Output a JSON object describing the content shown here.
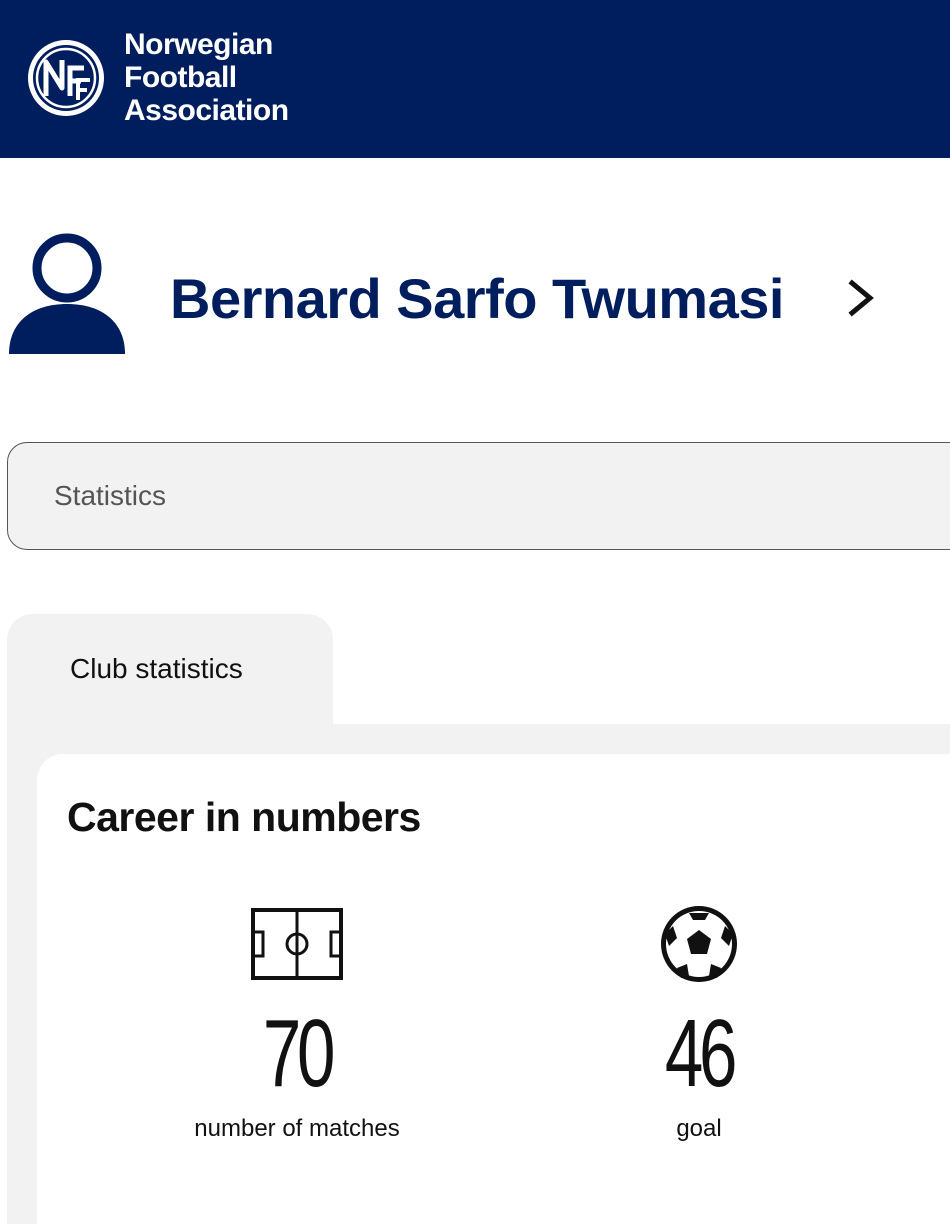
{
  "header": {
    "brand_line1": "Norwegian",
    "brand_line2": "Football",
    "brand_line3": "Association",
    "logo_icon": "nff-logo-icon",
    "background_color": "#001e5e"
  },
  "player": {
    "name": "Bernard Sarfo Twumasi",
    "avatar_icon": "person-icon",
    "chevron_icon": "chevron-right-icon",
    "name_color": "#001e5e"
  },
  "statistics_dropdown": {
    "label": "Statistics"
  },
  "tabs": [
    {
      "label": "Club statistics",
      "active": true
    }
  ],
  "career": {
    "title": "Career in numbers",
    "stats": [
      {
        "icon": "football-pitch-icon",
        "value": "70",
        "label": "number of matches"
      },
      {
        "icon": "football-ball-icon",
        "value": "46",
        "label": "goal"
      }
    ]
  }
}
